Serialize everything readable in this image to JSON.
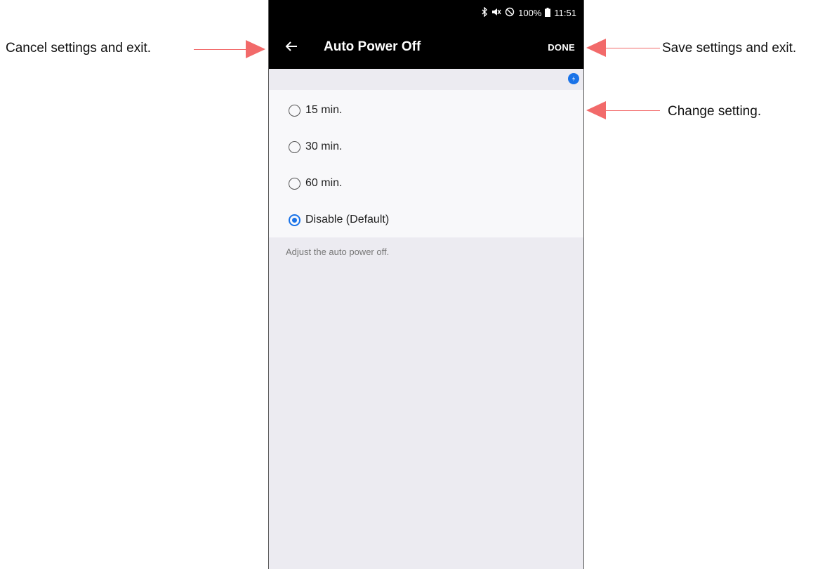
{
  "status_bar": {
    "battery": "100%",
    "time": "11:51"
  },
  "app_bar": {
    "title": "Auto Power Off",
    "done_label": "DONE"
  },
  "options": [
    {
      "label": "15 min.",
      "selected": false
    },
    {
      "label": "30 min.",
      "selected": false
    },
    {
      "label": "60 min.",
      "selected": false
    },
    {
      "label": "Disable (Default)",
      "selected": true
    }
  ],
  "description": "Adjust the auto power off.",
  "callouts": {
    "cancel": "Cancel settings and exit.",
    "save": "Save settings and exit.",
    "change": "Change setting."
  },
  "colors": {
    "accent": "#1a73e8",
    "arrow": "#f26a6a",
    "bar": "#000000"
  },
  "icons": [
    "bluetooth-icon",
    "mute-icon",
    "no-disturb-icon",
    "battery-icon",
    "back-arrow-icon",
    "sync-icon",
    "radio-icon"
  ]
}
